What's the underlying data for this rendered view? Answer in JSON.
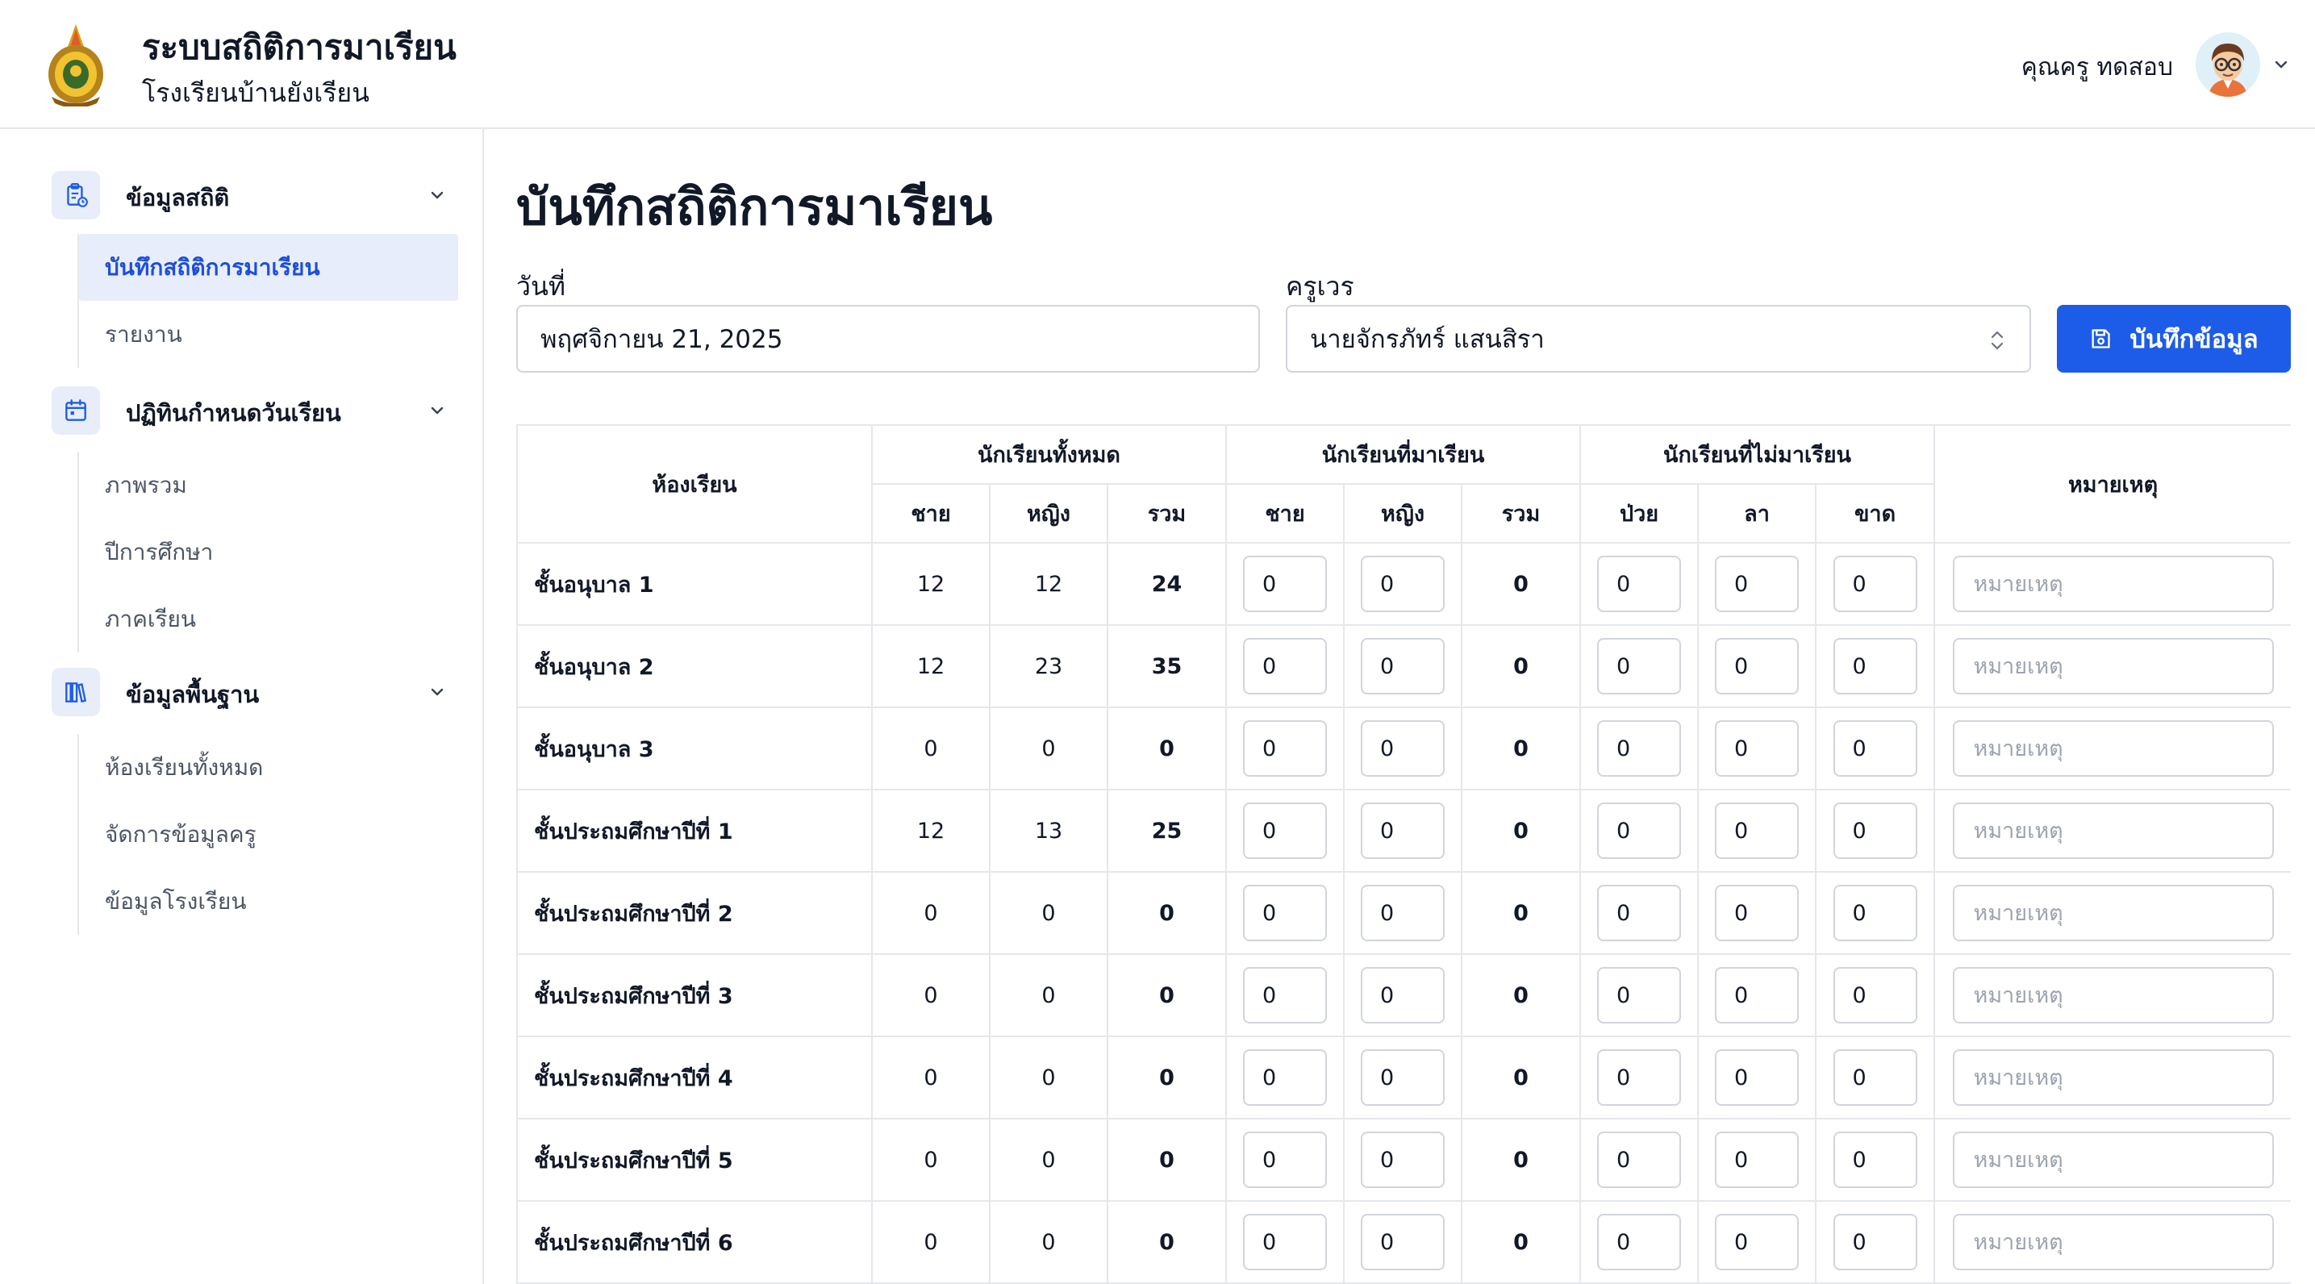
{
  "header": {
    "title": "ระบบสถิติการมาเรียน",
    "subtitle": "โรงเรียนบ้านยังเรียน",
    "user_name": "คุณครู ทดสอบ",
    "logo_icon": "school-crest-icon",
    "avatar_icon": "teacher-avatar-icon"
  },
  "sidebar": {
    "groups": [
      {
        "label": "ข้อมูลสถิติ",
        "icon": "clipboard-stats-icon",
        "items": [
          {
            "label": "บันทึกสถิติการมาเรียน",
            "active": true
          },
          {
            "label": "รายงาน"
          }
        ]
      },
      {
        "label": "ปฏิทินกำหนดวันเรียน",
        "icon": "calendar-icon",
        "items": [
          {
            "label": "ภาพรวม"
          },
          {
            "label": "ปีการศึกษา"
          },
          {
            "label": "ภาคเรียน"
          }
        ]
      },
      {
        "label": "ข้อมูลพื้นฐาน",
        "icon": "books-icon",
        "items": [
          {
            "label": "ห้องเรียนทั้งหมด"
          },
          {
            "label": "จัดการข้อมูลครู"
          },
          {
            "label": "ข้อมูลโรงเรียน"
          }
        ]
      }
    ]
  },
  "main": {
    "title": "บันทึกสถิติการมาเรียน",
    "date_label": "วันที่",
    "date_value": "พฤศจิกายน 21, 2025",
    "teacher_label": "ครูเวร",
    "teacher_value": "นายจักรภัทร์ แสนสิรา",
    "save_label": "บันทึกข้อมูล"
  },
  "table": {
    "headers": {
      "room": "ห้องเรียน",
      "total_group": "นักเรียนทั้งหมด",
      "present_group": "นักเรียนที่มาเรียน",
      "absent_group": "นักเรียนที่ไม่มาเรียน",
      "note": "หมายเหตุ",
      "male": "ชาย",
      "female": "หญิง",
      "sum": "รวม",
      "sick": "ป่วย",
      "leave": "ลา",
      "absent": "ขาด"
    },
    "note_placeholder": "หมายเหตุ",
    "rows": [
      {
        "room": "ชั้นอนุบาล 1",
        "male": "12",
        "female": "12",
        "total": "24",
        "p_male": "0",
        "p_female": "0",
        "p_total": "0",
        "sick": "0",
        "leave": "0",
        "absent": "0"
      },
      {
        "room": "ชั้นอนุบาล 2",
        "male": "12",
        "female": "23",
        "total": "35",
        "p_male": "0",
        "p_female": "0",
        "p_total": "0",
        "sick": "0",
        "leave": "0",
        "absent": "0"
      },
      {
        "room": "ชั้นอนุบาล 3",
        "male": "0",
        "female": "0",
        "total": "0",
        "p_male": "0",
        "p_female": "0",
        "p_total": "0",
        "sick": "0",
        "leave": "0",
        "absent": "0"
      },
      {
        "room": "ชั้นประถมศึกษาปีที่ 1",
        "male": "12",
        "female": "13",
        "total": "25",
        "p_male": "0",
        "p_female": "0",
        "p_total": "0",
        "sick": "0",
        "leave": "0",
        "absent": "0"
      },
      {
        "room": "ชั้นประถมศึกษาปีที่ 2",
        "male": "0",
        "female": "0",
        "total": "0",
        "p_male": "0",
        "p_female": "0",
        "p_total": "0",
        "sick": "0",
        "leave": "0",
        "absent": "0"
      },
      {
        "room": "ชั้นประถมศึกษาปีที่ 3",
        "male": "0",
        "female": "0",
        "total": "0",
        "p_male": "0",
        "p_female": "0",
        "p_total": "0",
        "sick": "0",
        "leave": "0",
        "absent": "0"
      },
      {
        "room": "ชั้นประถมศึกษาปีที่ 4",
        "male": "0",
        "female": "0",
        "total": "0",
        "p_male": "0",
        "p_female": "0",
        "p_total": "0",
        "sick": "0",
        "leave": "0",
        "absent": "0"
      },
      {
        "room": "ชั้นประถมศึกษาปีที่ 5",
        "male": "0",
        "female": "0",
        "total": "0",
        "p_male": "0",
        "p_female": "0",
        "p_total": "0",
        "sick": "0",
        "leave": "0",
        "absent": "0"
      },
      {
        "room": "ชั้นประถมศึกษาปีที่ 6",
        "male": "0",
        "female": "0",
        "total": "0",
        "p_male": "0",
        "p_female": "0",
        "p_total": "0",
        "sick": "0",
        "leave": "0",
        "absent": "0"
      }
    ]
  },
  "colors": {
    "primary": "#1d5ce8",
    "active_bg": "#e8edfb",
    "active_text": "#1d4ed8",
    "border": "#e5e7eb"
  }
}
